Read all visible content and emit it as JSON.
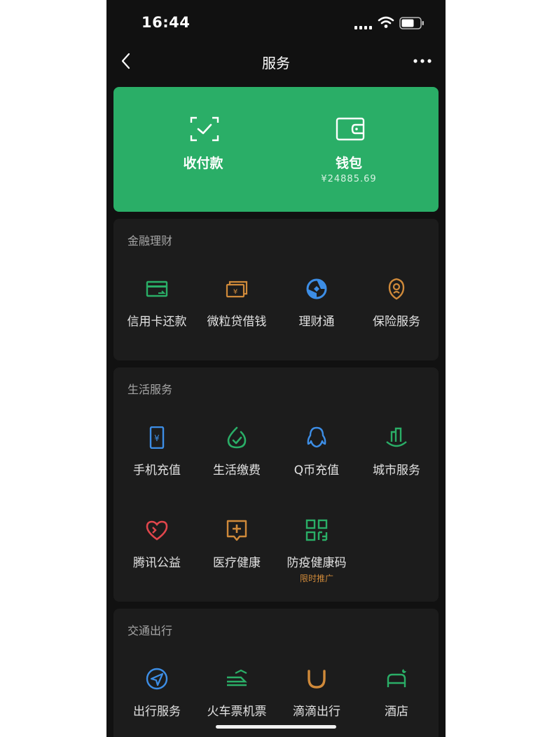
{
  "status_bar": {
    "time": "16:44"
  },
  "nav": {
    "title": "服务"
  },
  "pay_card": {
    "color": "#2aae67",
    "items": [
      {
        "label": "收付款",
        "icon": "scan-check-icon"
      },
      {
        "label": "钱包",
        "icon": "wallet-icon",
        "sub": "¥24885.69"
      }
    ]
  },
  "sections": [
    {
      "title": "金融理财",
      "items": [
        {
          "label": "信用卡还款",
          "icon": "credit-card-icon",
          "color": "#2aae67"
        },
        {
          "label": "微粒贷借钱",
          "icon": "loan-icon",
          "color": "#d08a3a"
        },
        {
          "label": "理财通",
          "icon": "wealth-icon",
          "color": "#3d8ee6"
        },
        {
          "label": "保险服务",
          "icon": "insurance-icon",
          "color": "#d08a3a"
        }
      ]
    },
    {
      "title": "生活服务",
      "items": [
        {
          "label": "手机充值",
          "icon": "phone-recharge-icon",
          "color": "#3d8ee6"
        },
        {
          "label": "生活缴费",
          "icon": "utility-payment-icon",
          "color": "#2aae67"
        },
        {
          "label": "Q币充值",
          "icon": "qq-penguin-icon",
          "color": "#3d8ee6"
        },
        {
          "label": "城市服务",
          "icon": "city-icon",
          "color": "#2aae67"
        },
        {
          "label": "腾讯公益",
          "icon": "charity-heart-icon",
          "color": "#e0464c"
        },
        {
          "label": "医疗健康",
          "icon": "medical-icon",
          "color": "#d08a3a"
        },
        {
          "label": "防疫健康码",
          "icon": "qr-code-icon",
          "color": "#2aae67",
          "sub": "限时推广"
        }
      ]
    },
    {
      "title": "交通出行",
      "items": [
        {
          "label": "出行服务",
          "icon": "navigation-icon",
          "color": "#3d8ee6"
        },
        {
          "label": "火车票机票",
          "icon": "train-icon",
          "color": "#2aae67"
        },
        {
          "label": "滴滴出行",
          "icon": "didi-icon",
          "color": "#d08a3a"
        },
        {
          "label": "酒店",
          "icon": "hotel-bed-icon",
          "color": "#2aae67"
        }
      ]
    }
  ]
}
